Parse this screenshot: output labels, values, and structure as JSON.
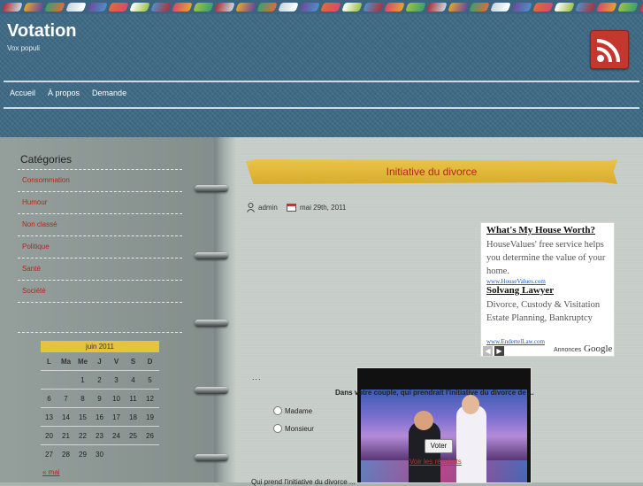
{
  "site": {
    "title": "Votation",
    "description": "Vox populi"
  },
  "colors": {
    "header_blue": "#3e6a86",
    "link_red": "#b3261e",
    "ribbon_gold": "#e3c43a",
    "rss_red": "#c4372d"
  },
  "icons": {
    "rss": "rss-icon",
    "author": "user-icon",
    "date": "calendar-icon"
  },
  "nav": {
    "items": [
      "Accueil",
      "À propos",
      "Demande"
    ]
  },
  "sidebar": {
    "categories_title": "Catégories",
    "categories": [
      "Consommation",
      "Humour",
      "Non classé",
      "Politique",
      "Santé",
      "Société"
    ],
    "calendar": {
      "caption": "juin 2011",
      "weekdays": [
        "L",
        "Ma",
        "Me",
        "J",
        "V",
        "S",
        "D"
      ],
      "weeks": [
        [
          "",
          "",
          "1",
          "2",
          "3",
          "4",
          "5"
        ],
        [
          "6",
          "7",
          "8",
          "9",
          "10",
          "11",
          "12"
        ],
        [
          "13",
          "14",
          "15",
          "16",
          "17",
          "18",
          "19"
        ],
        [
          "20",
          "21",
          "22",
          "23",
          "24",
          "25",
          "26"
        ],
        [
          "27",
          "28",
          "29",
          "30",
          "",
          "",
          ""
        ]
      ],
      "prev_link": "« mai"
    }
  },
  "post": {
    "title": "Initiative du divorce",
    "author": "admin",
    "date": "mai 29th, 2011",
    "ellipsis": "...",
    "poll": {
      "question": "Dans votre couple, qui prendrait l'initiative du divorce de ...",
      "options": [
        "Madame",
        "Monsieur"
      ],
      "vote_label": "Voter",
      "results_link": "Voir les résultats",
      "video_caption": "votre divorce  l'initiative du divorce"
    },
    "bottom_text": "Qui prend l'initiative du divorce ..."
  },
  "ad": {
    "entries": [
      {
        "title": "What's My House Worth?",
        "text": "HouseValues' free service helps you determine the value of your home.",
        "url": "www.HouseValues.com"
      },
      {
        "title": "Solvang Lawyer",
        "text": "Divorce, Custody & Visitation Estate Planning, Bankruptcy",
        "url": "www.EndertelLaw.com"
      }
    ],
    "annonces": "Annonces",
    "google": "Google"
  }
}
